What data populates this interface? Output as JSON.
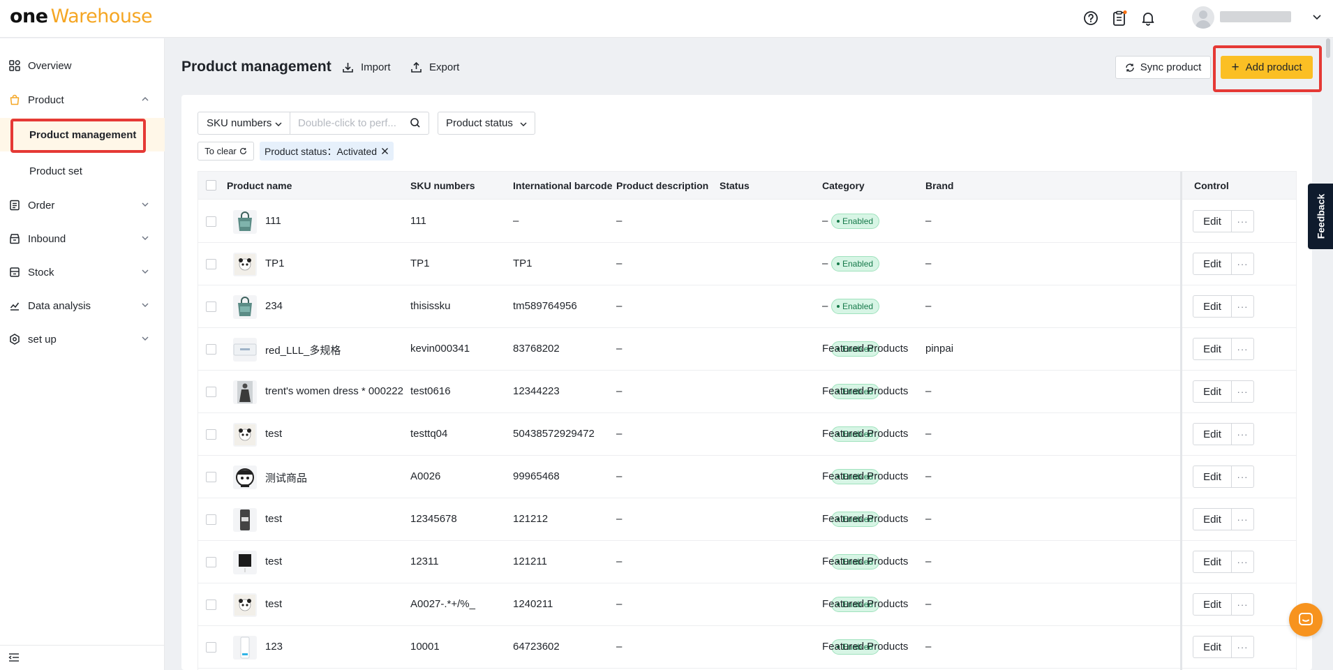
{
  "app": {
    "logo_one": "one",
    "logo_warehouse": "Warehouse",
    "accent_color": "#fbbf24",
    "highlight_color": "#e53935"
  },
  "topbar": {
    "icons": [
      "help-icon",
      "clipboard-icon",
      "bell-icon",
      "avatar",
      "chevron-down-icon"
    ]
  },
  "sidebar": {
    "overview": "Overview",
    "product": "Product",
    "product_management": "Product management",
    "product_set": "Product set",
    "order": "Order",
    "inbound": "Inbound",
    "stock": "Stock",
    "data_analysis": "Data analysis",
    "setup": "set up"
  },
  "header": {
    "title": "Product management",
    "import_label": "Import",
    "export_label": "Export",
    "sync_label": "Sync product",
    "add_label": "Add product"
  },
  "filters": {
    "sku_select": "SKU numbers",
    "search_placeholder": "Double-click to perf...",
    "status_select": "Product status",
    "clear_label": "To clear",
    "active_tag": "Product status：Activated"
  },
  "table": {
    "columns": {
      "name": "Product name",
      "sku": "SKU numbers",
      "barcode": "International barcode",
      "description": "Product description",
      "status": "Status",
      "category": "Category",
      "brand": "Brand",
      "control": "Control"
    },
    "edit_label": "Edit",
    "more_label": "···",
    "rows": [
      {
        "thumb": "bag",
        "name": "111",
        "sku": "111",
        "barcode": "–",
        "description": "–",
        "status": "Enabled",
        "category": "–",
        "brand": "–"
      },
      {
        "thumb": "panda",
        "name": "TP1",
        "sku": "TP1",
        "barcode": "TP1",
        "description": "–",
        "status": "Enabled",
        "category": "–",
        "brand": "–"
      },
      {
        "thumb": "bag",
        "name": "234",
        "sku": "thisissku",
        "barcode": "tm589764956",
        "description": "–",
        "status": "Enabled",
        "category": "–",
        "brand": "–"
      },
      {
        "thumb": "card",
        "name": "red_LLL_多规格",
        "sku": "kevin000341",
        "barcode": "83768202",
        "description": "–",
        "status": "Enabled",
        "category": "Featured Products",
        "brand": "pinpai"
      },
      {
        "thumb": "dress",
        "name": "trent's women dress * 000222",
        "sku": "test0616",
        "barcode": "12344223",
        "description": "–",
        "status": "Enabled",
        "category": "Featured Products",
        "brand": "–"
      },
      {
        "thumb": "panda",
        "name": "test",
        "sku": "testtq04",
        "barcode": "50438572929472",
        "description": "–",
        "status": "Enabled",
        "category": "Featured Products",
        "brand": "–"
      },
      {
        "thumb": "face",
        "name": "测试商品",
        "sku": "A0026",
        "barcode": "99965468",
        "description": "–",
        "status": "Enabled",
        "category": "Featured Products",
        "brand": "–"
      },
      {
        "thumb": "device",
        "name": "test",
        "sku": "12345678",
        "barcode": "121212",
        "description": "–",
        "status": "Enabled",
        "category": "Featured Products",
        "brand": "–"
      },
      {
        "thumb": "black",
        "name": "test",
        "sku": "12311",
        "barcode": "121211",
        "description": "–",
        "status": "Enabled",
        "category": "Featured Products",
        "brand": "–"
      },
      {
        "thumb": "panda",
        "name": "test",
        "sku": "A0027-.*+/%_",
        "barcode": "1240211",
        "description": "–",
        "status": "Enabled",
        "category": "Featured Products",
        "brand": "–"
      },
      {
        "thumb": "phone",
        "name": "123",
        "sku": "10001",
        "barcode": "64723602",
        "description": "–",
        "status": "Enabled",
        "category": "Featured Products",
        "brand": "–"
      }
    ]
  },
  "right_tools": {
    "feedback_label": "Feedback"
  }
}
